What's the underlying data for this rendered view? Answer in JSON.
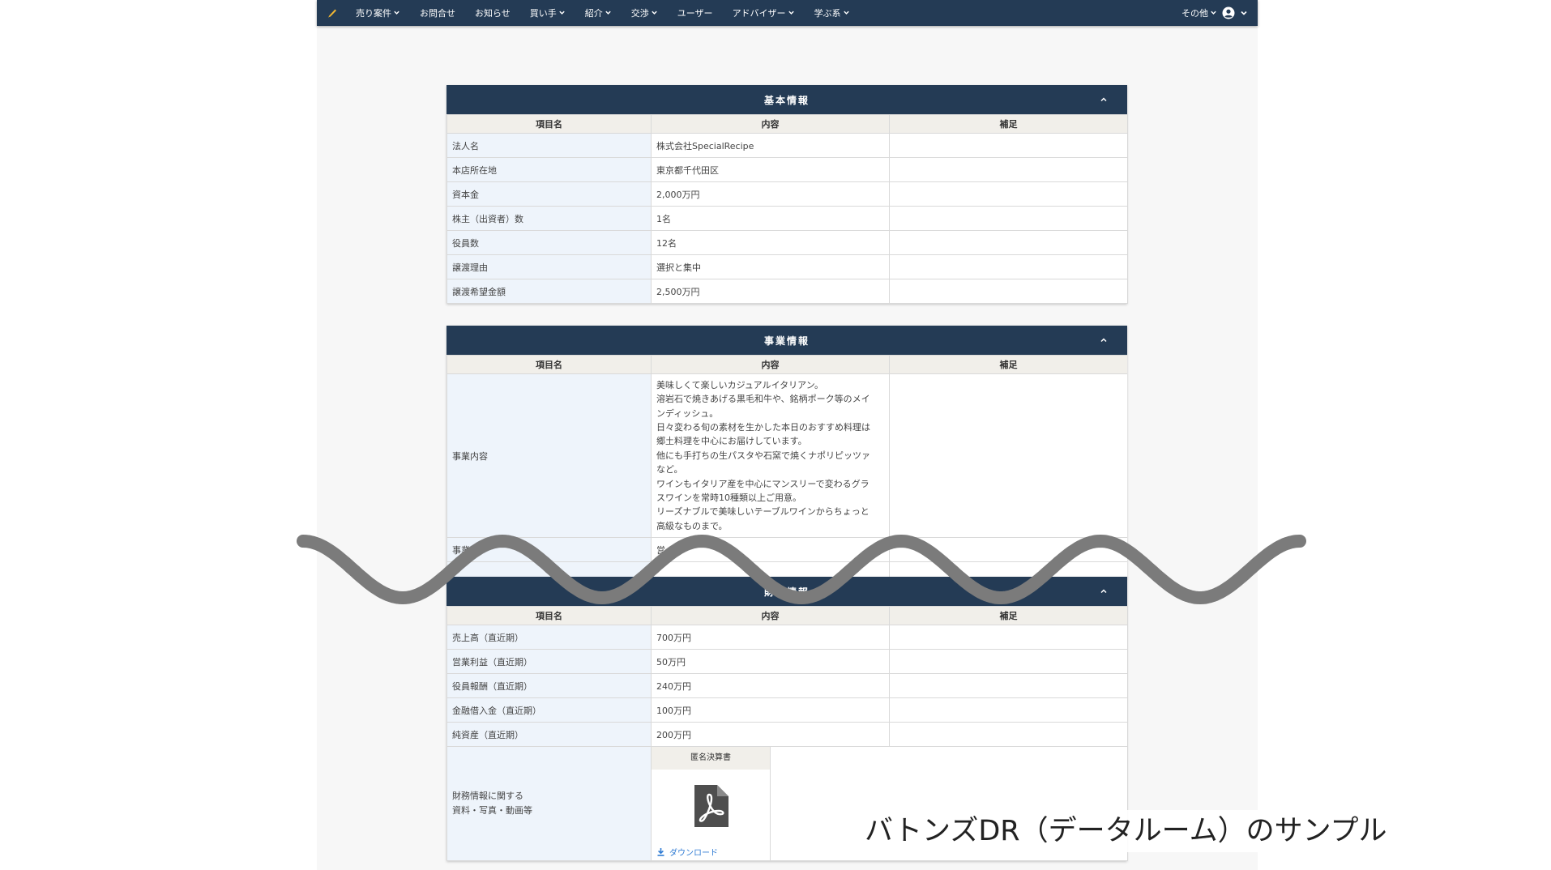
{
  "navbar": {
    "items": [
      {
        "label": "売り案件",
        "dropdown": true
      },
      {
        "label": "お問合せ",
        "dropdown": false
      },
      {
        "label": "お知らせ",
        "dropdown": false
      },
      {
        "label": "買い手",
        "dropdown": true
      },
      {
        "label": "紹介",
        "dropdown": true
      },
      {
        "label": "交渉",
        "dropdown": true
      },
      {
        "label": "ユーザー",
        "dropdown": false
      },
      {
        "label": "アドバイザー",
        "dropdown": true
      },
      {
        "label": "学ぶ系",
        "dropdown": true
      }
    ],
    "other_label": "その他"
  },
  "headers": {
    "item": "項目名",
    "content": "内容",
    "note": "補足"
  },
  "basic_info": {
    "title": "基本情報",
    "rows": [
      {
        "label": "法人名",
        "content": "株式会社SpecialRecipe",
        "note": ""
      },
      {
        "label": "本店所在地",
        "content": "東京都千代田区",
        "note": ""
      },
      {
        "label": "資本金",
        "content": "2,000万円",
        "note": ""
      },
      {
        "label": "株主（出資者）数",
        "content": "1名",
        "note": ""
      },
      {
        "label": "役員数",
        "content": "12名",
        "note": ""
      },
      {
        "label": "譲渡理由",
        "content": "選択と集中",
        "note": ""
      },
      {
        "label": "譲渡希望金額",
        "content": "2,500万円",
        "note": ""
      }
    ]
  },
  "business_info": {
    "title": "事業情報",
    "description_label": "事業内容",
    "description_lines": [
      "美味しくて楽しいカジュアルイタリアン。",
      "溶岩石で焼きあげる黒毛和牛や、銘柄ポーク等のメイ",
      "ンディッシュ。",
      "日々変わる旬の素材を生かした本日のおすすめ料理は",
      "郷土料理を中心にお届けしています。",
      "他にも手打ちの生パスタや石窯で焼くナポリピッツァ",
      "など。",
      "ワインもイタリア産を中心にマンスリーで変わるグラ",
      "スワインを常時10種類以上ご用意。",
      "リーズナブルで美味しいテーブルワインからちょっと",
      "高級なものまで。"
    ],
    "row2_label": "事業",
    "row2_content": "営"
  },
  "financial_info": {
    "title": "財務情報",
    "rows": [
      {
        "label": "売上高（直近期）",
        "content": "700万円",
        "note": ""
      },
      {
        "label": "営業利益（直近期）",
        "content": "50万円",
        "note": ""
      },
      {
        "label": "役員報酬（直近期）",
        "content": "240万円",
        "note": ""
      },
      {
        "label": "金融借入金（直近期）",
        "content": "100万円",
        "note": ""
      },
      {
        "label": "純資産（直近期）",
        "content": "200万円",
        "note": ""
      }
    ],
    "materials_label_line1": "財務情報に関する",
    "materials_label_line2": "資料・写真・動画等",
    "document": {
      "title": "匿名決算書",
      "download_label": "ダウンロード"
    }
  },
  "caption": "バトンズDR（データルーム）のサンプル",
  "colors": {
    "navy": "#243b55",
    "label_bg": "#eef4fb",
    "header_bg": "#f1efea",
    "link": "#2f7bd3",
    "wave": "#7b7b7b"
  }
}
